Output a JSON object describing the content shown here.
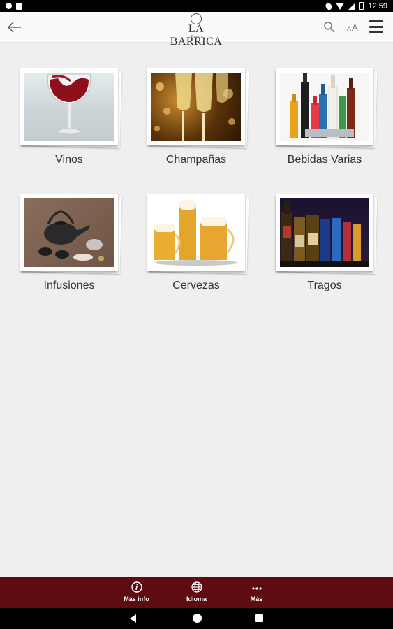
{
  "status_bar": {
    "time": "12:59"
  },
  "app_bar": {
    "logo_title": "LA BARRICA",
    "logo_subtitle": "Resto"
  },
  "categories": [
    {
      "label": "Vinos"
    },
    {
      "label": "Champañas"
    },
    {
      "label": "Bebidas Varias"
    },
    {
      "label": "Infusiones"
    },
    {
      "label": "Cervezas"
    },
    {
      "label": "Tragos"
    }
  ],
  "bottom_nav": {
    "items": [
      {
        "label": "Más info",
        "icon": "info-icon"
      },
      {
        "label": "Idioma",
        "icon": "globe-icon"
      },
      {
        "label": "Más",
        "icon": "more-icon"
      }
    ]
  },
  "colors": {
    "bottom_nav_bg": "#5e0b11",
    "background": "#efefef"
  }
}
